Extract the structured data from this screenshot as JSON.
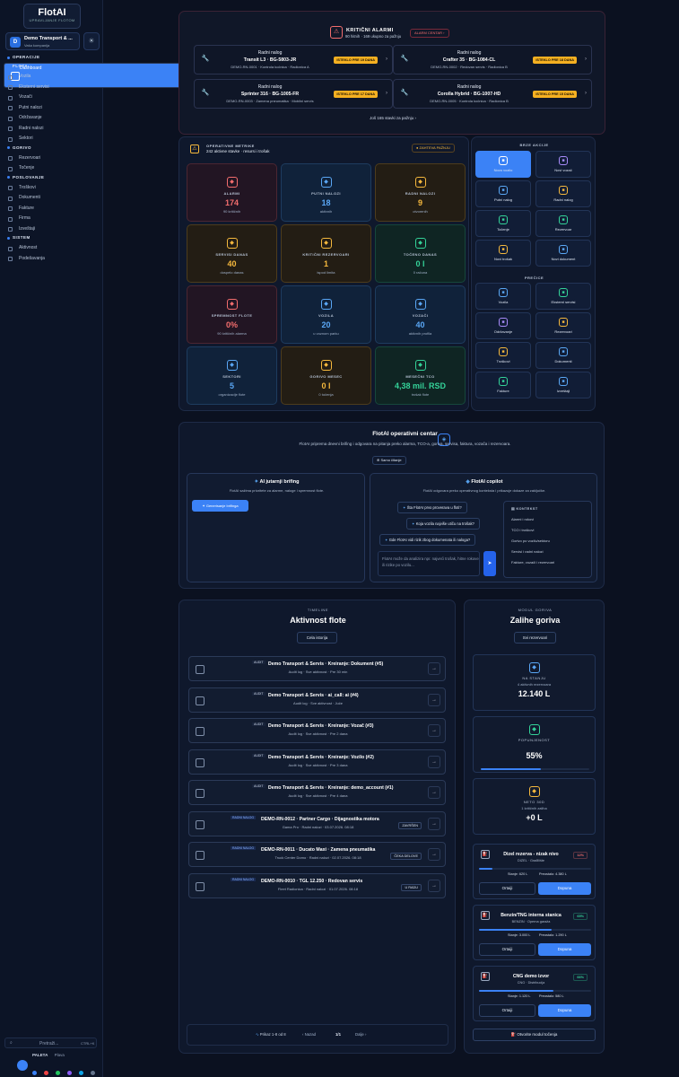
{
  "sidebar": {
    "logo_title": "FlotAI",
    "logo_sub": "UPRAVLJANJE FLOTOM",
    "company_avatar": "D",
    "company_name": "Demo Transport & ...",
    "company_sub": "Vaša kompanija",
    "sections": [
      {
        "title": "OPERACIJE",
        "items": [
          {
            "label": "Dashboard",
            "active": true
          }
        ]
      },
      {
        "title": "FLOTA",
        "items": [
          {
            "label": "Vozila"
          },
          {
            "label": "Eksterni servisi"
          },
          {
            "label": "Vozači"
          },
          {
            "label": "Putni nalozi"
          },
          {
            "label": "Održavanje"
          },
          {
            "label": "Radni nalozi"
          },
          {
            "label": "Sektori"
          }
        ]
      },
      {
        "title": "GORIVO",
        "items": [
          {
            "label": "Rezervoari"
          },
          {
            "label": "Točenje"
          }
        ]
      },
      {
        "title": "POSLOVANJE",
        "items": [
          {
            "label": "Troškovi"
          },
          {
            "label": "Dokumenti"
          },
          {
            "label": "Fakture"
          },
          {
            "label": "Firma"
          },
          {
            "label": "Izveštaji"
          }
        ]
      },
      {
        "title": "SISTEM",
        "items": [
          {
            "label": "Aktivnost"
          },
          {
            "label": "Podešavanja"
          }
        ]
      }
    ],
    "search_label": "Pretraži...",
    "search_kbd": "CTRL+K",
    "palette_label": "PALETA",
    "palette_value": "Plava",
    "palette_colors": [
      "#3b82f6",
      "#ef4444",
      "#22c55e",
      "#8b5cf6",
      "#0ea5e9",
      "#64748b"
    ]
  },
  "alerts": {
    "title": "KRITIČNI ALARMI",
    "subtitle": "90 hitnih · 169 ukupno za pažnju",
    "center_button": "ALARM CENTAR",
    "items": [
      {
        "t1": "Radni nalog",
        "t2": "Transit L3 · BG-5803-JR",
        "t3": "DEMO-RN-0001 · Kontrola kočnica · Radionica A",
        "badge": "ISTEKLO PRE 19 DANA"
      },
      {
        "t1": "Radni nalog",
        "t2": "Crafter 35 · BG-1084-CL",
        "t3": "DEMO-RN-0002 · Redovan servis · Radionica B",
        "badge": "ISTEKLO PRE 18 DANA"
      },
      {
        "t1": "Radni nalog",
        "t2": "Sprinter 316 · BG-1005-FR",
        "t3": "DEMO-RN-0003 · Zamena pneumatika · Mobilni servis",
        "badge": "ISTEKLO PRE 17 DANA"
      },
      {
        "t1": "Radni nalog",
        "t2": "Corolla Hybrid · BG-1007-HD",
        "t3": "DEMO-RN-0005 · Kontrola kočnica · Radionica B",
        "badge": "ISTEKLO PRE 15 DANA"
      }
    ],
    "more": "Još 165 stavki za pažnju"
  },
  "metrics": {
    "title": "OPERATIVNE METRIKE",
    "subtitle": "242 aktivne stavke · resursi i trošak",
    "attention": "ZAHTEVA PAŽNJU",
    "kpis": [
      {
        "label": "ALARMI",
        "value": "174",
        "sub": "90 kritičnih",
        "color": "#f26d6d",
        "bg": "#221523"
      },
      {
        "label": "PUTNI NALOZI",
        "value": "18",
        "sub": "aktivnih",
        "color": "#5aa7f5",
        "bg": "#10223a"
      },
      {
        "label": "RADNI NALOZI",
        "value": "9",
        "sub": "otvorenih",
        "color": "#f5b83d",
        "bg": "#231d14"
      },
      {
        "label": "SERVISI DANAS",
        "value": "40",
        "sub": "dospelo danas",
        "color": "#f5b83d",
        "bg": "#231d14"
      },
      {
        "label": "KRITIČNI REZERVOARI",
        "value": "1",
        "sub": "ispod limita",
        "color": "#f5b83d",
        "bg": "#231d14"
      },
      {
        "label": "TOČENO DANAS",
        "value": "0 l",
        "sub": "0 računa",
        "color": "#34d399",
        "bg": "#0f2523"
      },
      {
        "label": "SPREMNOST FLOTE",
        "value": "0%",
        "sub": "90 kritičnih alarma",
        "color": "#f26d6d",
        "bg": "#221523"
      },
      {
        "label": "VOZILA",
        "value": "20",
        "sub": "u voznom parku",
        "color": "#5aa7f5",
        "bg": "#10223a"
      },
      {
        "label": "VOZAČI",
        "value": "40",
        "sub": "aktivnih profila",
        "color": "#5aa7f5",
        "bg": "#10223a"
      },
      {
        "label": "SEKTORI",
        "value": "5",
        "sub": "organizacije flote",
        "color": "#5aa7f5",
        "bg": "#10223a"
      },
      {
        "label": "GORIVO MESEC",
        "value": "0 l",
        "sub": "0 točenja",
        "color": "#f5b83d",
        "bg": "#231d14"
      },
      {
        "label": "MESEČNI TCO",
        "value": "4,38 mil. RSD",
        "sub": "trošak flote",
        "color": "#34d399",
        "bg": "#0f2523"
      }
    ]
  },
  "quick": {
    "title": "BRZE AKCIJE",
    "actions": [
      {
        "label": "Novo vozilo",
        "primary": true,
        "color": "#ffffff"
      },
      {
        "label": "Novi vozač",
        "color": "#a78bfa"
      },
      {
        "label": "Putni nalog",
        "color": "#5aa7f5"
      },
      {
        "label": "Radni nalog",
        "color": "#f5b83d"
      },
      {
        "label": "Točenje",
        "color": "#34d399"
      },
      {
        "label": "Rezervoar",
        "color": "#34d399"
      },
      {
        "label": "Novi trošak",
        "color": "#f5b83d"
      },
      {
        "label": "Novi dokument",
        "color": "#5aa7f5"
      }
    ],
    "shortcuts_title": "PREČICE",
    "shortcuts": [
      {
        "label": "Vozila",
        "color": "#5aa7f5"
      },
      {
        "label": "Eksterni servisi",
        "color": "#34d399"
      },
      {
        "label": "Održavanje",
        "color": "#a78bfa"
      },
      {
        "label": "Rezervoari",
        "color": "#f5b83d"
      },
      {
        "label": "Troškovi",
        "color": "#f5b83d"
      },
      {
        "label": "Dokumenti",
        "color": "#5aa7f5"
      },
      {
        "label": "Fakture",
        "color": "#34d399"
      },
      {
        "label": "Izveštaji",
        "color": "#5aa7f5"
      }
    ]
  },
  "ops": {
    "title": "FlotAI operativni centar",
    "subtitle": "FlotAI priprema dnevni brifing i odgovara na pitanja preko alarma, TCO-a, goriva, servisa, faktura, vozača i rezervoara.",
    "badge": "Samo čitanje",
    "briefing_title": "AI jutarnji brifing",
    "briefing_sub": "FlotAI sažima prioritete za alarme, naloge i spremnost flote.",
    "briefing_button": "Generisanje brifinga",
    "copilot_title": "FlotAI copilot",
    "copilot_sub": "FlotAI odgovara preko operativnog konteksta i prikazuje dokaze za zaključke.",
    "questions": [
      "Šta FlotAI prvo proverava u floti?",
      "Koja vozila najviše utiču na trošak?",
      "Gde FlotAI vidi rizik zbog dokumenata ili naloga?"
    ],
    "input_placeholder": "FlotAI može da analizira npr. najveći trošak, hitne rokove ili rizike po vozilu...",
    "context_title": "KONTEKST",
    "context": [
      "Alarmi i rokovi",
      "TCO i troškovi",
      "Gorivo po vozilu/sektoru",
      "Servisi i radni nalozi",
      "Fakture, vozači i rezervoari"
    ]
  },
  "timeline": {
    "kicker": "TIMELINE",
    "title": "Aktivnost flote",
    "button": "Cela istorija",
    "items": [
      {
        "tag": "AUDIT",
        "title": "Demo Transport & Servis · Kreiranje: Dokument (#5)",
        "sub": "Audit log · Sve aktivnost · Pre 30 min"
      },
      {
        "tag": "AUDIT",
        "title": "Demo Transport & Servis · ai_call: ai (#4)",
        "sub": "Audit log · Sve aktivnost · Juče"
      },
      {
        "tag": "AUDIT",
        "title": "Demo Transport & Servis · Kreiranje: Vozač (#3)",
        "sub": "Audit log · Sve aktivnost · Pre 2 dana"
      },
      {
        "tag": "AUDIT",
        "title": "Demo Transport & Servis · Kreiranje: Vozilo (#2)",
        "sub": "Audit log · Sve aktivnost · Pre 3 dana"
      },
      {
        "tag": "AUDIT",
        "title": "Demo Transport & Servis · Kreiranje: demo_account (#1)",
        "sub": "Audit log · Sve aktivnost · Pre 4 dana"
      },
      {
        "tag": "RADNI NALOG",
        "title": "DEMO-RN-0012 · Partner Cargo · Dijagnostika motora",
        "sub": "Gama Pro · Radni nalozi · 03.07.2026. 08:18",
        "status": "ZAVRŠEN"
      },
      {
        "tag": "RADNI NALOG",
        "title": "DEMO-RN-0011 · Ducato Maxi · Zamena pneumatika",
        "sub": "Truck Center Domo · Radni nalozi · 02.07.2026. 08:18",
        "status": "ČEKA DELOVE"
      },
      {
        "tag": "RADNI NALOG",
        "title": "DEMO-RN-0010 · TGL 12.250 · Redovan servis",
        "sub": "Fleet Radionica · Radni nalozi · 01.07.2026. 08:18",
        "status": "U RADU"
      }
    ],
    "pager_info": "Prikaz 1-8 od 8",
    "prev": "Nazad",
    "page": "1/1",
    "next": "Dalje"
  },
  "fuel": {
    "kicker": "MODUL GORIVA",
    "title": "Zalihe goriva",
    "button": "Svi rezervoari",
    "stats": [
      {
        "label": "NA STANJU",
        "sub": "4 aktivnih rezervoara",
        "value": "12.140 L",
        "color": "#5aa7f5",
        "fill": 0
      },
      {
        "label": "POPUNJENOST",
        "sub": "",
        "value": "55%",
        "color": "#34d399",
        "fill": 0.55
      },
      {
        "label": "NETO 30D",
        "sub": "1 kritičnih zaliha",
        "value": "+0 L",
        "color": "#f5b83d",
        "fill": 0
      }
    ],
    "tanks": [
      {
        "name": "Dizel rezerva - nizak nivo",
        "type": "DIZEL",
        "loc": "Građilište",
        "badge": "12%",
        "badge_color": "#f26d6d",
        "fill": 0.12,
        "stanje": "Stanje: 620 L",
        "preostalo": "Preostalo: 4.380 L",
        "left": "Ortaiji",
        "right": "Dopuna"
      },
      {
        "name": "Benzin/TNG interna stanica",
        "type": "BENZIN",
        "loc": "Operna garaža",
        "badge": "65%",
        "badge_color": "#34d399",
        "fill": 0.65,
        "stanje": "Stanje: 3.000 L",
        "preostalo": "Preostalo: 1.290 L",
        "left": "Ortaiji",
        "right": "Dopuna"
      },
      {
        "name": "CNG demo izvor",
        "type": "CNG",
        "loc": "Distribucija",
        "badge": "66%",
        "badge_color": "#34d399",
        "fill": 0.66,
        "stanje": "Stanje: 1.120 L",
        "preostalo": "Preostalo: 580 L",
        "left": "Ortaiji",
        "right": "Dopuna"
      }
    ],
    "footer_button": "Otvorite modul točenja"
  }
}
